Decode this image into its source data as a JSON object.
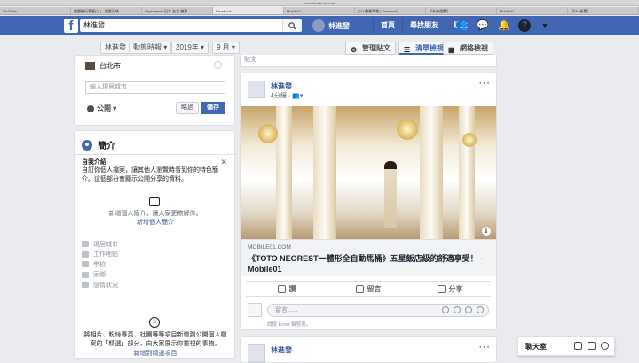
{
  "browser": {
    "url": "www.facebook.com",
    "tabs": [
      "YouTube",
      "遊戲機行事曆(21) - 遊戲天地 ...",
      "Skyscanner 日本 台北 機票 ...",
      "Facebook",
      "Mobile01 ...",
      "(21) 動態時報 | Facebook",
      "【未來遠矚】 ...",
      "Mobile01 ...",
      "【Mo 新聞】 ..."
    ]
  },
  "topbar": {
    "search_value": "林進發",
    "user_name": "林進發",
    "links": [
      "首頁",
      "尋找朋友",
      "建立"
    ]
  },
  "timeline_bar": {
    "name_tab": "林進發",
    "view_select": "動態時報",
    "year_select": "2019年",
    "month_select": "9 月",
    "manage_posts": "管理貼文",
    "list_view": "清單檢視",
    "grid_view": "網格檢視"
  },
  "location_card": {
    "city": "台北市",
    "city_placeholder": "輸入現居城市",
    "privacy": "公開",
    "cancel": "略過",
    "save": "儲存"
  },
  "intro": {
    "title": "簡介",
    "bio_title": "自我介紹",
    "bio_desc": "自訂你個人檔案，讓其他人瀏覽時看到你的特色簡介。這個部分會顯示公開分享的資料。",
    "add_hint": "新增個人簡介，讓大家更瞭解你。",
    "add_link": "新增個人簡介",
    "items": [
      "現居城市",
      "工作地點",
      "學校",
      "家鄉",
      "感情狀況"
    ],
    "featured_desc": "將相片、粉絲專頁、社團等等項目新增到公開個人檔案的「精選」部分，向大家展示你重視的事物。",
    "featured_link": "新增到精選項目"
  },
  "post": {
    "top_label": "貼文",
    "author": "林進發",
    "time": "4分鐘",
    "link_domain": "MOBILE01.COM",
    "link_title": "《TOTO NEOREST一體形全自動馬桶》五星飯店級的舒適享受！ - Mobile01",
    "actions": [
      "讚",
      "留言",
      "分享"
    ],
    "comment_placeholder": "留言......",
    "comment_hint": "請按 Enter 鍵發表。"
  },
  "post2": {
    "author": "林進發"
  },
  "chat": {
    "label": "聊天室"
  }
}
